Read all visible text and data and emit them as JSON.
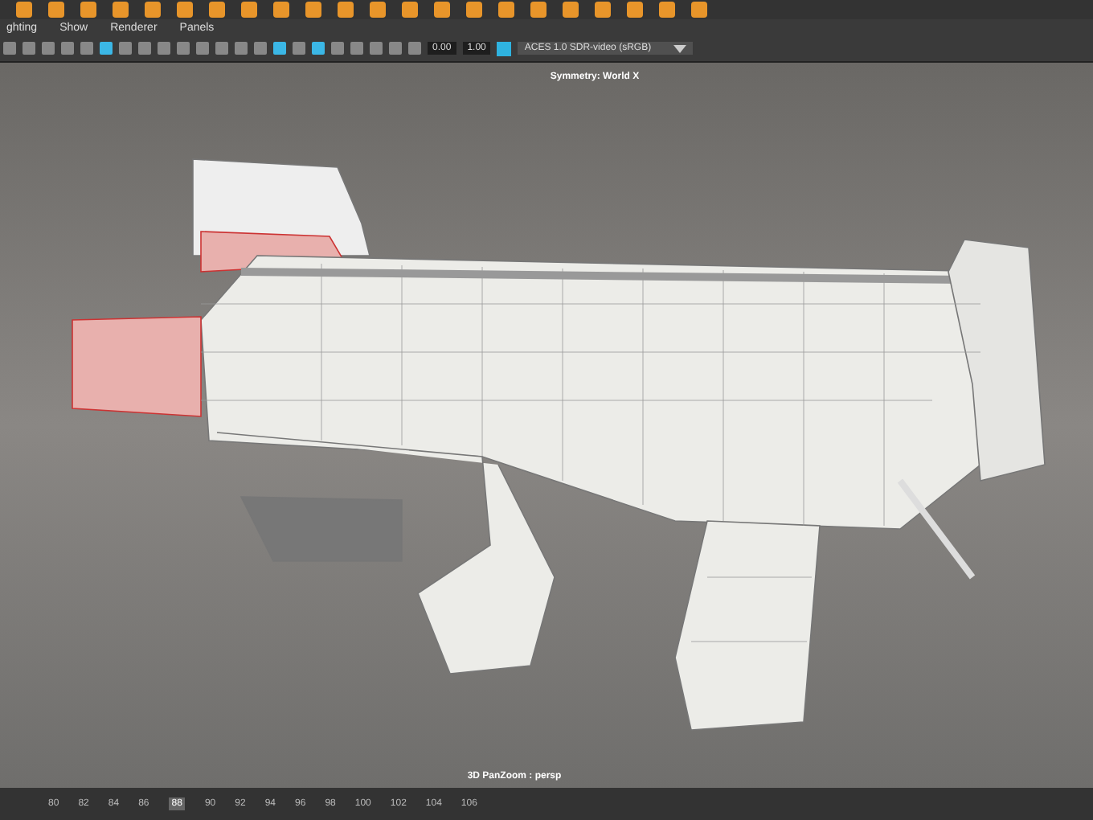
{
  "panel_menu": [
    {
      "label": "ghting"
    },
    {
      "label": "Show"
    },
    {
      "label": "Renderer"
    },
    {
      "label": "Panels"
    }
  ],
  "view_toolbar": {
    "icons": [
      {
        "selected": false
      },
      {
        "selected": false
      },
      {
        "selected": false
      },
      {
        "selected": false
      },
      {
        "selected": false
      },
      {
        "selected": true
      },
      {
        "selected": false
      },
      {
        "selected": false
      },
      {
        "selected": false
      },
      {
        "selected": false
      },
      {
        "selected": false
      },
      {
        "selected": false
      },
      {
        "selected": false
      },
      {
        "selected": false
      },
      {
        "selected": true
      },
      {
        "selected": false
      },
      {
        "selected": true
      },
      {
        "selected": false
      },
      {
        "selected": false
      },
      {
        "selected": false
      },
      {
        "selected": false
      },
      {
        "selected": false
      }
    ],
    "exposure": "0.00",
    "gamma": "1.00",
    "color_space": "ACES 1.0 SDR-video (sRGB)"
  },
  "viewport": {
    "symmetry_label": "Symmetry: World X",
    "camera_label": "3D PanZoom : persp"
  },
  "timeline": {
    "frames": [
      {
        "label": "80",
        "selected": false
      },
      {
        "label": "82",
        "selected": false
      },
      {
        "label": "84",
        "selected": false
      },
      {
        "label": "86",
        "selected": false
      },
      {
        "label": "88",
        "selected": true
      },
      {
        "label": "90",
        "selected": false
      },
      {
        "label": "92",
        "selected": false
      },
      {
        "label": "94",
        "selected": false
      },
      {
        "label": "96",
        "selected": false
      },
      {
        "label": "98",
        "selected": false
      },
      {
        "label": "100",
        "selected": false
      },
      {
        "label": "102",
        "selected": false
      },
      {
        "label": "104",
        "selected": false
      },
      {
        "label": "106",
        "selected": false
      }
    ]
  }
}
